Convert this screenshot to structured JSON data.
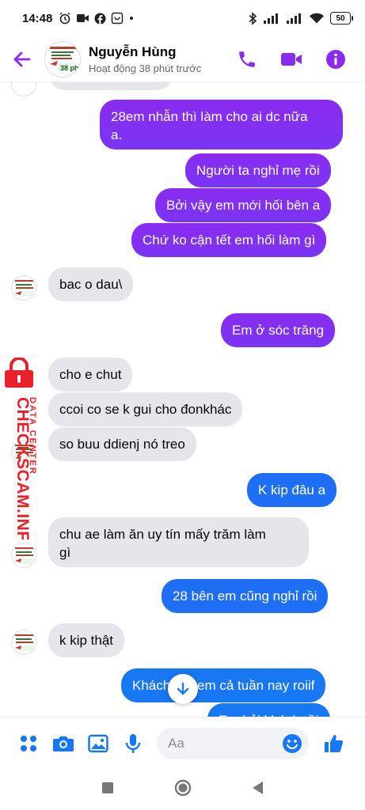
{
  "status_bar": {
    "time": "14:48",
    "battery": "50"
  },
  "header": {
    "contact_name": "Nguyễn Hùng",
    "contact_status": "Hoạt động 38 phút trước",
    "avatar_badge": "38 ph"
  },
  "messages": [
    {
      "side": "out",
      "text_lines": [
        "28em nhẫn thì làm cho ai dc nữa",
        "a."
      ]
    },
    {
      "side": "out",
      "text": "Người ta nghỉ mẹ rồi"
    },
    {
      "side": "out",
      "text": "Bởi vậy em mới hối bên a"
    },
    {
      "side": "out",
      "text": "Chứ ko cận tết em hối làm gì"
    },
    {
      "side": "in",
      "text": "bac o dau\\"
    },
    {
      "side": "out",
      "text": "Em ở sóc trăng"
    },
    {
      "side": "in",
      "text": "cho e chut"
    },
    {
      "side": "in",
      "text": "ccoi co se k gui cho đonkhác"
    },
    {
      "side": "in",
      "text": "so buu ddienj nó treo"
    },
    {
      "side": "out",
      "text": "K kip đâu a"
    },
    {
      "side": "in",
      "text_lines": [
        "chu ae làm ăn uy tín mấy trăm làm",
        "gì"
      ]
    },
    {
      "side": "out",
      "text": "28 bên em cũng nghỉ rồi"
    },
    {
      "side": "in",
      "text": "k kip thật"
    },
    {
      "side": "out",
      "text": "Khách đợi em cả tuần nay roiif"
    },
    {
      "side": "out",
      "text": "Em hỏi khách rồi"
    }
  ],
  "composer": {
    "placeholder": "Aa"
  },
  "watermark": {
    "brand": "CHECKSCAM.INFO",
    "subtitle": "DATA CENTER"
  },
  "colors": {
    "accent": "#8a2cf0",
    "outgoing_purple": "#7a34f2",
    "outgoing_blue": "#1877f2",
    "incoming": "#e4e6eb",
    "watermark_red": "#e8212b"
  },
  "icons": {
    "back": "back-arrow-icon",
    "call": "phone-icon",
    "video": "video-camera-icon",
    "info": "info-icon",
    "menu": "four-dots-icon",
    "camera": "camera-icon",
    "gallery": "image-icon",
    "mic": "microphone-icon",
    "emoji": "emoji-icon",
    "like": "thumbs-up-icon",
    "scroll": "arrow-down-icon"
  }
}
